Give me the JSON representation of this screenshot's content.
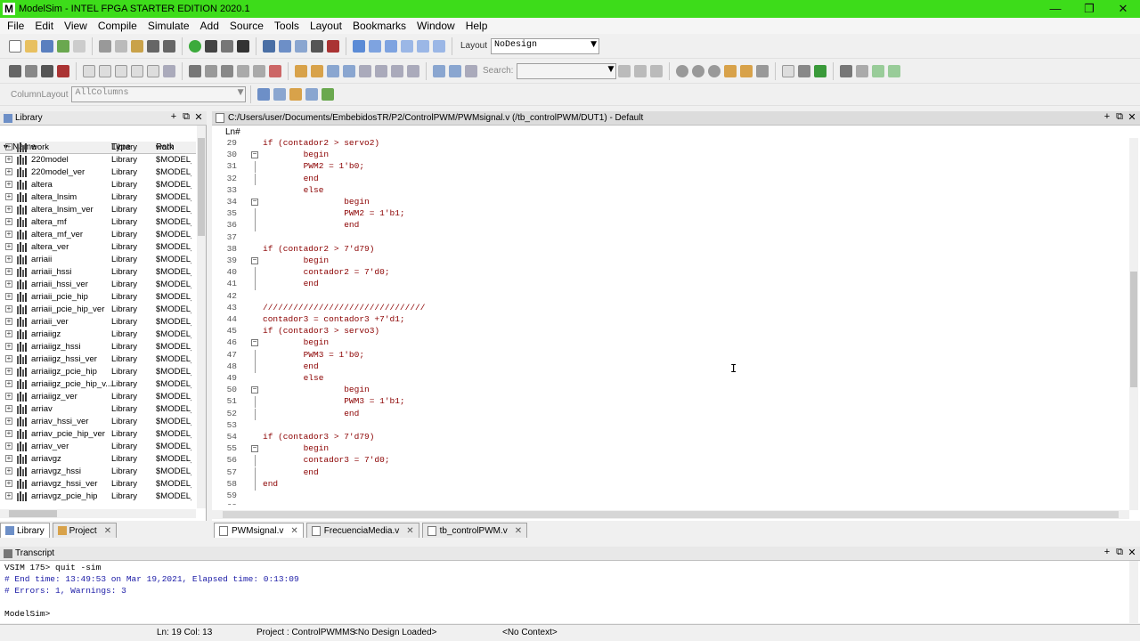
{
  "window": {
    "title": "ModelSim - INTEL FPGA STARTER EDITION 2020.1",
    "logo": "M",
    "minimize": "—",
    "restore": "❐",
    "close": "✕"
  },
  "menu": [
    "File",
    "Edit",
    "View",
    "Compile",
    "Simulate",
    "Add",
    "Source",
    "Tools",
    "Layout",
    "Bookmarks",
    "Window",
    "Help"
  ],
  "toolbar": {
    "layout_label": "Layout",
    "layout_value": "NoDesign",
    "search_label": "Search:",
    "search_value": "",
    "column_layout_label": "ColumnLayout",
    "column_layout_value": "AllColumns"
  },
  "library": {
    "title": "Library",
    "columns": [
      "Name",
      "Type",
      "Path"
    ],
    "rows": [
      {
        "name": "work",
        "type": "Library",
        "path": "work"
      },
      {
        "name": "220model",
        "type": "Library",
        "path": "$MODEL_"
      },
      {
        "name": "220model_ver",
        "type": "Library",
        "path": "$MODEL_"
      },
      {
        "name": "altera",
        "type": "Library",
        "path": "$MODEL_"
      },
      {
        "name": "altera_lnsim",
        "type": "Library",
        "path": "$MODEL_"
      },
      {
        "name": "altera_lnsim_ver",
        "type": "Library",
        "path": "$MODEL_"
      },
      {
        "name": "altera_mf",
        "type": "Library",
        "path": "$MODEL_"
      },
      {
        "name": "altera_mf_ver",
        "type": "Library",
        "path": "$MODEL_"
      },
      {
        "name": "altera_ver",
        "type": "Library",
        "path": "$MODEL_"
      },
      {
        "name": "arriaii",
        "type": "Library",
        "path": "$MODEL_"
      },
      {
        "name": "arriaii_hssi",
        "type": "Library",
        "path": "$MODEL_"
      },
      {
        "name": "arriaii_hssi_ver",
        "type": "Library",
        "path": "$MODEL_"
      },
      {
        "name": "arriaii_pcie_hip",
        "type": "Library",
        "path": "$MODEL_"
      },
      {
        "name": "arriaii_pcie_hip_ver",
        "type": "Library",
        "path": "$MODEL_"
      },
      {
        "name": "arriaii_ver",
        "type": "Library",
        "path": "$MODEL_"
      },
      {
        "name": "arriaiigz",
        "type": "Library",
        "path": "$MODEL_"
      },
      {
        "name": "arriaiigz_hssi",
        "type": "Library",
        "path": "$MODEL_"
      },
      {
        "name": "arriaiigz_hssi_ver",
        "type": "Library",
        "path": "$MODEL_"
      },
      {
        "name": "arriaiigz_pcie_hip",
        "type": "Library",
        "path": "$MODEL_"
      },
      {
        "name": "arriaiigz_pcie_hip_v...",
        "type": "Library",
        "path": "$MODEL_"
      },
      {
        "name": "arriaiigz_ver",
        "type": "Library",
        "path": "$MODEL_"
      },
      {
        "name": "arriav",
        "type": "Library",
        "path": "$MODEL_"
      },
      {
        "name": "arriav_hssi_ver",
        "type": "Library",
        "path": "$MODEL_"
      },
      {
        "name": "arriav_pcie_hip_ver",
        "type": "Library",
        "path": "$MODEL_"
      },
      {
        "name": "arriav_ver",
        "type": "Library",
        "path": "$MODEL_"
      },
      {
        "name": "arriavgz",
        "type": "Library",
        "path": "$MODEL_"
      },
      {
        "name": "arriavgz_hssi",
        "type": "Library",
        "path": "$MODEL_"
      },
      {
        "name": "arriavgz_hssi_ver",
        "type": "Library",
        "path": "$MODEL_"
      },
      {
        "name": "arriavgz_pcie_hip",
        "type": "Library",
        "path": "$MODEL_"
      }
    ],
    "bottom_tabs": [
      "Library",
      "Project"
    ]
  },
  "editor": {
    "path_title": "C:/Users/user/Documents/EmbebidosTR/P2/ControlPWM/PWMsignal.v (/tb_controlPWM/DUT1) - Default",
    "ln_header": "Ln#",
    "lines": [
      {
        "n": "29",
        "fold": "",
        "bar": false,
        "text": "if (contador2 > servo2)"
      },
      {
        "n": "30",
        "fold": "−",
        "bar": false,
        "text": "        begin"
      },
      {
        "n": "31",
        "fold": "",
        "bar": true,
        "text": "        PWM2 = 1'b0;"
      },
      {
        "n": "32",
        "fold": "",
        "bar": true,
        "text": "        end"
      },
      {
        "n": "33",
        "fold": "",
        "bar": false,
        "text": "        else"
      },
      {
        "n": "34",
        "fold": "−",
        "bar": false,
        "text": "                begin"
      },
      {
        "n": "35",
        "fold": "",
        "bar": true,
        "text": "                PWM2 = 1'b1;"
      },
      {
        "n": "36",
        "fold": "",
        "bar": true,
        "text": "                end"
      },
      {
        "n": "37",
        "fold": "",
        "bar": false,
        "text": ""
      },
      {
        "n": "38",
        "fold": "",
        "bar": false,
        "text": "if (contador2 > 7'd79)"
      },
      {
        "n": "39",
        "fold": "−",
        "bar": false,
        "text": "        begin"
      },
      {
        "n": "40",
        "fold": "",
        "bar": true,
        "text": "        contador2 = 7'd0;"
      },
      {
        "n": "41",
        "fold": "",
        "bar": true,
        "text": "        end"
      },
      {
        "n": "42",
        "fold": "",
        "bar": false,
        "text": ""
      },
      {
        "n": "43",
        "fold": "",
        "bar": false,
        "text": "////////////////////////////////"
      },
      {
        "n": "44",
        "fold": "",
        "bar": false,
        "text": "contador3 = contador3 +7'd1;"
      },
      {
        "n": "45",
        "fold": "",
        "bar": false,
        "text": "if (contador3 > servo3)"
      },
      {
        "n": "46",
        "fold": "−",
        "bar": false,
        "text": "        begin"
      },
      {
        "n": "47",
        "fold": "",
        "bar": true,
        "text": "        PWM3 = 1'b0;"
      },
      {
        "n": "48",
        "fold": "",
        "bar": true,
        "text": "        end"
      },
      {
        "n": "49",
        "fold": "",
        "bar": false,
        "text": "        else"
      },
      {
        "n": "50",
        "fold": "−",
        "bar": false,
        "text": "                begin"
      },
      {
        "n": "51",
        "fold": "",
        "bar": true,
        "text": "                PWM3 = 1'b1;"
      },
      {
        "n": "52",
        "fold": "",
        "bar": true,
        "text": "                end"
      },
      {
        "n": "53",
        "fold": "",
        "bar": false,
        "text": ""
      },
      {
        "n": "54",
        "fold": "",
        "bar": false,
        "text": "if (contador3 > 7'd79)"
      },
      {
        "n": "55",
        "fold": "−",
        "bar": false,
        "text": "        begin"
      },
      {
        "n": "56",
        "fold": "",
        "bar": true,
        "text": "        contador3 = 7'd0;"
      },
      {
        "n": "57",
        "fold": "",
        "bar": true,
        "text": "        end"
      },
      {
        "n": "58",
        "fold": "",
        "bar": true,
        "text": "end"
      },
      {
        "n": "59",
        "fold": "",
        "bar": false,
        "text": ""
      },
      {
        "n": "60",
        "fold": "",
        "bar": false,
        "text": ""
      }
    ],
    "tabs": [
      "PWMsignal.v",
      "FrecuenciaMedia.v",
      "tb_controlPWM.v"
    ]
  },
  "transcript": {
    "title": "Transcript",
    "lines": [
      {
        "text": "VSIM 175> quit -sim",
        "color": "#000000"
      },
      {
        "text": "# End time: 13:49:53 on Mar 19,2021, Elapsed time: 0:13:09",
        "color": "#1a1aa6"
      },
      {
        "text": "# Errors: 1, Warnings: 3",
        "color": "#1a1aa6"
      },
      {
        "text": "",
        "color": "#000000"
      },
      {
        "text": "ModelSim>",
        "color": "#000000"
      }
    ]
  },
  "status": {
    "ln_col": "Ln:  19  Col: 13",
    "project": "Project : ControlPWMMS",
    "design": "<No Design Loaded>",
    "context": "<No Context>"
  },
  "colors": {
    "titlebar": "#3ddc1a",
    "code_text": "#8b0000",
    "transcript_comment": "#1a1aa6",
    "panel_header": "#e8e8e8"
  }
}
